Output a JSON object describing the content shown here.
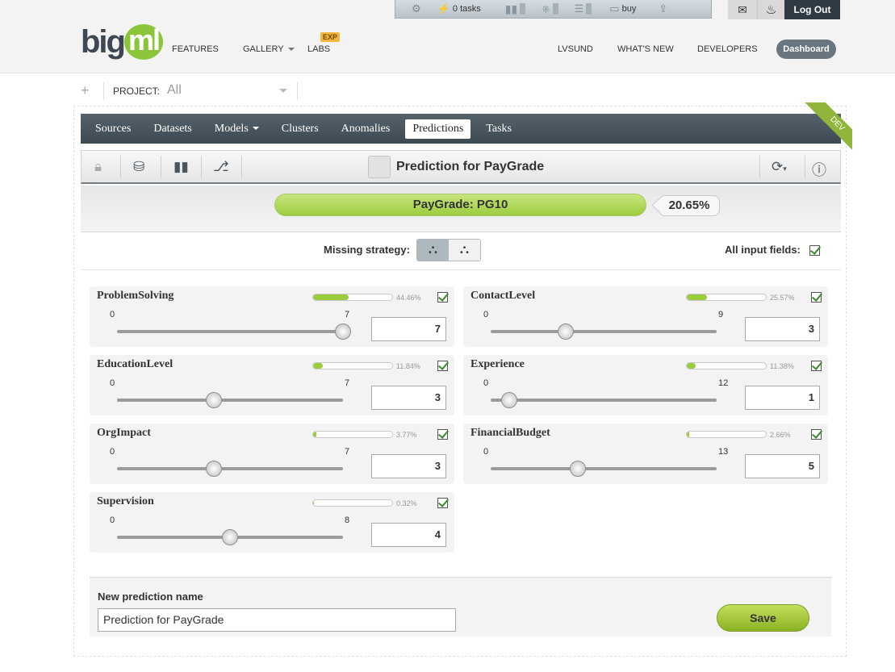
{
  "topbar": {
    "tasks_label": "0 tasks",
    "buy_label": "buy"
  },
  "header": {
    "logo_big": "big",
    "logo_ml": "ml",
    "nav": {
      "features": "FEATURES",
      "gallery": "GALLERY",
      "labs": "LABS",
      "labs_badge": "EXP",
      "user": "LVSUND",
      "whats_new": "WHAT'S NEW",
      "developers": "DEVELOPERS"
    },
    "dashboard": "Dashboard",
    "logout": "Log Out"
  },
  "project": {
    "label": "PROJECT:",
    "value": "All"
  },
  "tabs": [
    "Sources",
    "Datasets",
    "Models",
    "Clusters",
    "Anomalies",
    "Predictions",
    "Tasks"
  ],
  "active_tab": "Predictions",
  "ribbon": "DEV",
  "toolbar": {
    "title": "Prediction for PayGrade"
  },
  "result": {
    "label": "PayGrade: PG10",
    "confidence": "20.65%",
    "fill": 1.0
  },
  "options": {
    "missing_strategy_label": "Missing strategy:",
    "all_inputs_label": "All input fields:",
    "all_inputs_checked": true
  },
  "fields": [
    {
      "name": "ProblemSolving",
      "importance": 0.4446,
      "importance_label": "44.46%",
      "min": "0",
      "max": "7",
      "value": "7",
      "checked": true
    },
    {
      "name": "ContactLevel",
      "importance": 0.2557,
      "importance_label": "25.57%",
      "min": "0",
      "max": "9",
      "value": "3",
      "checked": true
    },
    {
      "name": "EducationLevel",
      "importance": 0.1184,
      "importance_label": "11.84%",
      "min": "0",
      "max": "7",
      "value": "3",
      "checked": true
    },
    {
      "name": "Experience",
      "importance": 0.1138,
      "importance_label": "11.38%",
      "min": "0",
      "max": "12",
      "value": "1",
      "checked": true
    },
    {
      "name": "OrgImpact",
      "importance": 0.0377,
      "importance_label": "3.77%",
      "min": "0",
      "max": "7",
      "value": "3",
      "checked": true
    },
    {
      "name": "FinancialBudget",
      "importance": 0.0266,
      "importance_label": "2.66%",
      "min": "0",
      "max": "13",
      "value": "5",
      "checked": true
    },
    {
      "name": "Supervision",
      "importance": 0.0032,
      "importance_label": "0.32%",
      "min": "0",
      "max": "8",
      "value": "4",
      "checked": true
    }
  ],
  "save": {
    "name_label": "New prediction name",
    "name_value": "Prediction for PayGrade",
    "button": "Save"
  },
  "colors": {
    "accent_green": "#9acc3e",
    "nav_dark": "#3e4a52",
    "dashboard": "#697680"
  }
}
